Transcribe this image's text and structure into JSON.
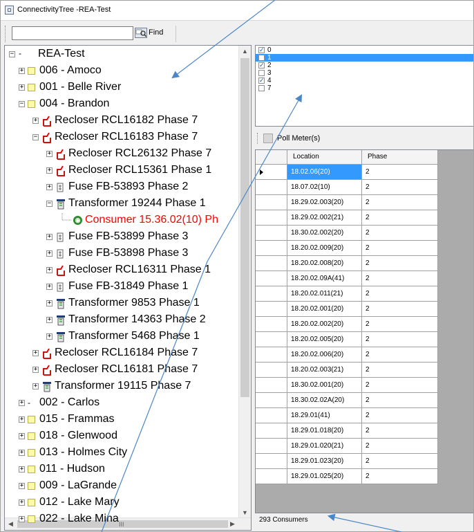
{
  "window": {
    "title": "ConnectivityTree -REA-Test"
  },
  "toolbar": {
    "search_value": "",
    "find_label": "Find"
  },
  "tree": {
    "root": "REA-Test",
    "items": [
      {
        "label": "006 - Amoco"
      },
      {
        "label": "001 - Belle River"
      },
      {
        "label": "004 - Brandon"
      },
      {
        "label": "Recloser RCL16182 Phase 7"
      },
      {
        "label": "Recloser RCL16183 Phase 7"
      },
      {
        "label": "Recloser RCL26132 Phase 7"
      },
      {
        "label": "Recloser RCL15361 Phase 1"
      },
      {
        "label": "Fuse FB-53893 Phase 2"
      },
      {
        "label": "Transformer 19244 Phase 1"
      },
      {
        "label": "Consumer 15.36.02(10) Ph"
      },
      {
        "label": "Fuse FB-53899 Phase 3"
      },
      {
        "label": "Fuse FB-53898 Phase 3"
      },
      {
        "label": "Recloser RCL16311 Phase 1"
      },
      {
        "label": "Fuse FB-31849 Phase 1"
      },
      {
        "label": "Transformer 9853 Phase 1"
      },
      {
        "label": "Transformer 14363 Phase 2"
      },
      {
        "label": "Transformer 5468 Phase 1"
      },
      {
        "label": "Recloser RCL16184 Phase 7"
      },
      {
        "label": "Recloser RCL16181 Phase 7"
      },
      {
        "label": "Transformer 19115 Phase 7"
      },
      {
        "label": "002 - Carlos"
      },
      {
        "label": "015 - Frammas"
      },
      {
        "label": "018 - Glenwood"
      },
      {
        "label": "013 - Holmes City"
      },
      {
        "label": "011 - Hudson"
      },
      {
        "label": "009 - LaGrande"
      },
      {
        "label": "012 - Lake Mary"
      },
      {
        "label": "022 - Lake Mina"
      }
    ],
    "hscroll_grip": "III"
  },
  "phases": [
    {
      "label": "0",
      "checked": true,
      "selected": false
    },
    {
      "label": "1",
      "checked": false,
      "selected": true
    },
    {
      "label": "2",
      "checked": true,
      "selected": false
    },
    {
      "label": "3",
      "checked": false,
      "selected": false
    },
    {
      "label": "4",
      "checked": true,
      "selected": false
    },
    {
      "label": "7",
      "checked": false,
      "selected": false
    }
  ],
  "poll": {
    "label": "Poll Meter(s)"
  },
  "grid": {
    "columns": [
      "Location",
      "Phase"
    ],
    "rows": [
      [
        "18.02.06(20)",
        "2"
      ],
      [
        "18.07.02(10)",
        "2"
      ],
      [
        "18.29.02.003(20)",
        "2"
      ],
      [
        "18.29.02.002(21)",
        "2"
      ],
      [
        "18.30.02.002(20)",
        "2"
      ],
      [
        "18.20.02.009(20)",
        "2"
      ],
      [
        "18.20.02.008(20)",
        "2"
      ],
      [
        "18.20.02.09A(41)",
        "2"
      ],
      [
        "18.20.02.011(21)",
        "2"
      ],
      [
        "18.20.02.001(20)",
        "2"
      ],
      [
        "18.20.02.002(20)",
        "2"
      ],
      [
        "18.20.02.005(20)",
        "2"
      ],
      [
        "18.20.02.006(20)",
        "2"
      ],
      [
        "18.20.02.003(21)",
        "2"
      ],
      [
        "18.30.02.001(20)",
        "2"
      ],
      [
        "18.30.02.02A(20)",
        "2"
      ],
      [
        "18.29.01(41)",
        "2"
      ],
      [
        "18.29.01.018(20)",
        "2"
      ],
      [
        "18.29.01.020(21)",
        "2"
      ],
      [
        "18.29.01.023(20)",
        "2"
      ],
      [
        "18.29.01.025(20)",
        "2"
      ]
    ]
  },
  "status": {
    "text": "293 Consumers"
  },
  "colors": {
    "selection": "#3399ff",
    "consumer_text": "#ff0000",
    "annotation_arrow": "#4a86c8"
  }
}
